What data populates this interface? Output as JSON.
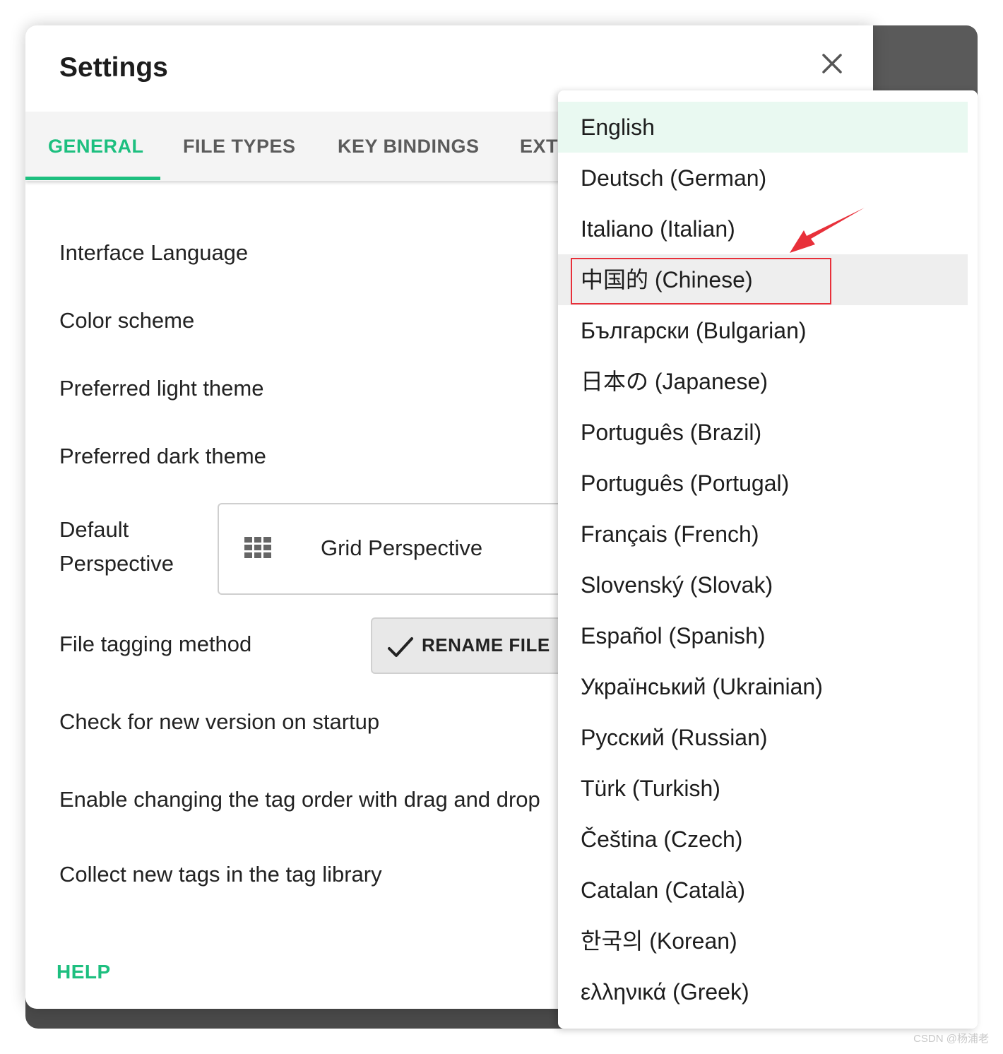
{
  "dialog": {
    "title": "Settings",
    "close_icon": "close-icon"
  },
  "tabs": [
    {
      "label": "GENERAL",
      "active": true
    },
    {
      "label": "FILE TYPES",
      "active": false
    },
    {
      "label": "KEY BINDINGS",
      "active": false
    },
    {
      "label": "EXT",
      "active": false
    }
  ],
  "settings": {
    "interface_language": "Interface Language",
    "color_scheme": "Color scheme",
    "preferred_light_theme": "Preferred light theme",
    "preferred_dark_theme": "Preferred dark theme",
    "default_perspective_line1": "Default",
    "default_perspective_line2": "Perspective",
    "default_perspective_value": "Grid Perspective",
    "file_tagging_method": "File tagging method",
    "file_tagging_value": "RENAME FILE",
    "check_new_version": "Check for new version on startup",
    "enable_tag_drag": "Enable changing the tag order with drag and drop",
    "collect_new_tags": "Collect new tags in the tag library"
  },
  "footer": {
    "help_label": "HELP"
  },
  "language_menu": {
    "selected": "English",
    "highlighted": "中国的 (Chinese)",
    "items": [
      "English",
      "Deutsch (German)",
      "Italiano (Italian)",
      "中国的 (Chinese)",
      "Български (Bulgarian)",
      "日本の (Japanese)",
      "Português (Brazil)",
      "Português (Portugal)",
      "Français (French)",
      "Slovenský (Slovak)",
      "Español (Spanish)",
      "Український (Ukrainian)",
      "Русский (Russian)",
      "Türk (Turkish)",
      "Čeština (Czech)",
      "Catalan (Català)",
      "한국의 (Korean)",
      "ελληνικά (Greek)"
    ]
  },
  "colors": {
    "accent": "#1dbf7f",
    "annotation": "#e8303a",
    "selected_bg": "#e9f9f1"
  },
  "watermark": "CSDN @杨浦老"
}
